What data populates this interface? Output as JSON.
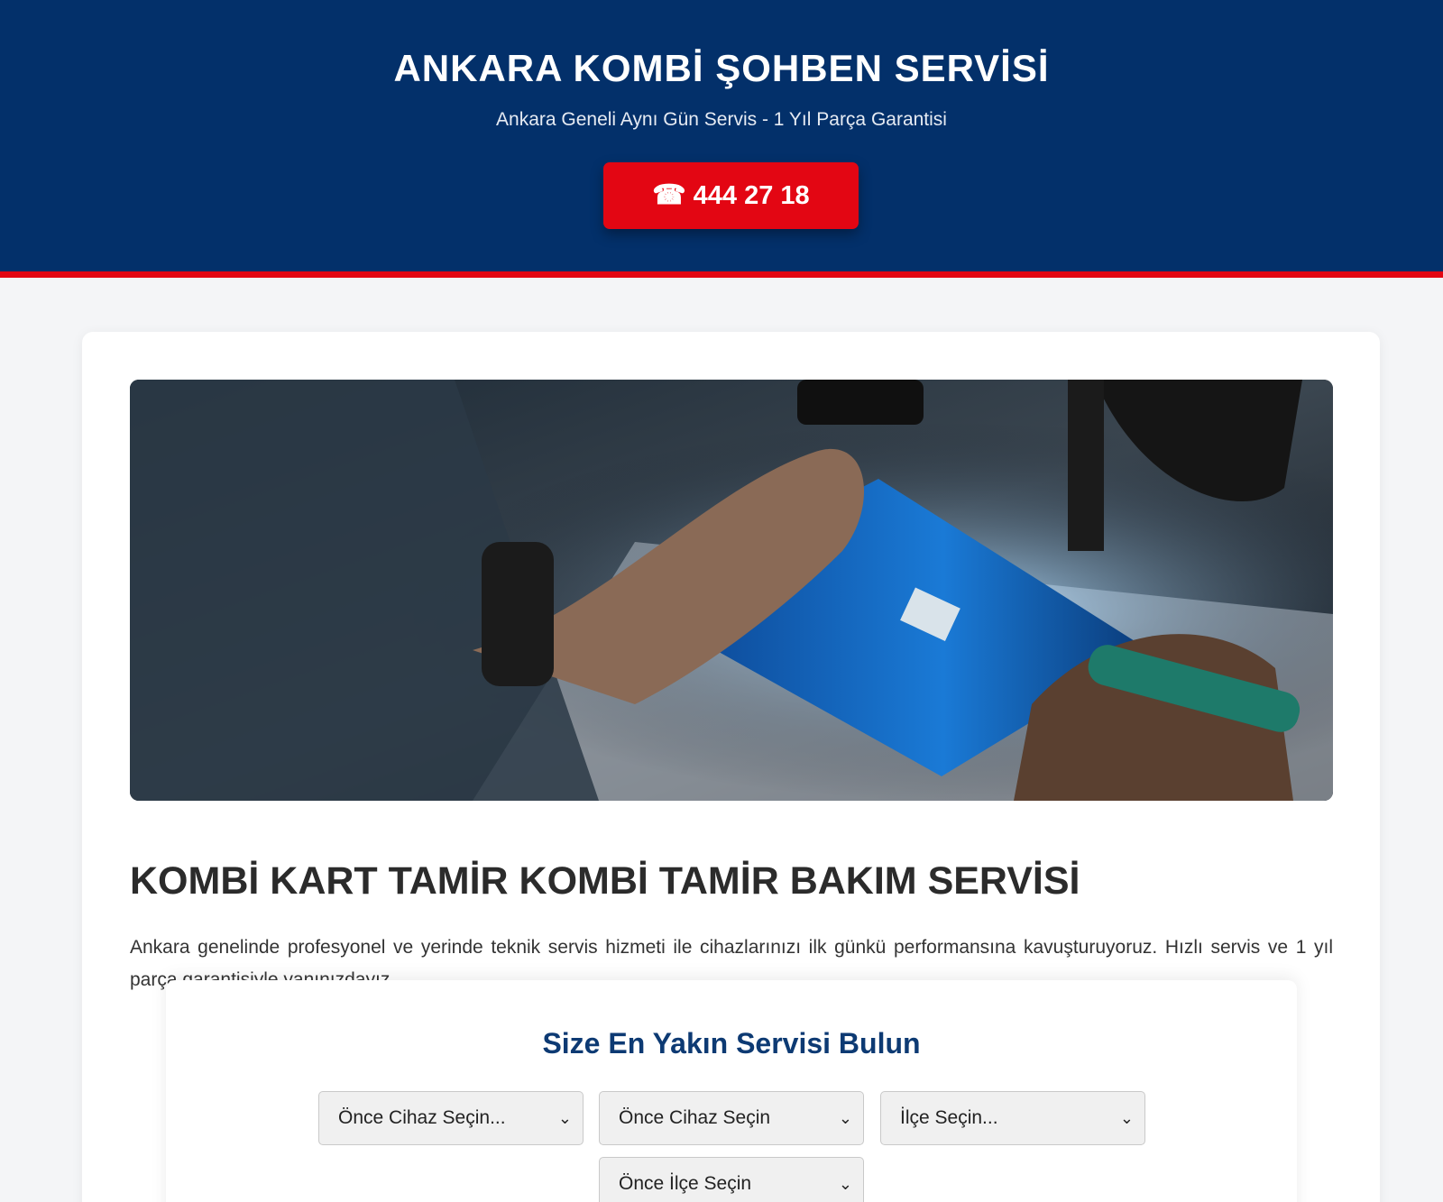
{
  "header": {
    "title": "ANKARA KOMBİ ŞOHBEN SERVİSİ",
    "subtitle": "Ankara Geneli Aynı Gün Servis - 1 Yıl Parça Garantisi",
    "call_button": {
      "icon": "phone-icon",
      "glyph": "☎",
      "label": "444 27 18"
    },
    "colors": {
      "background": "#03306a",
      "accent": "#e30613"
    }
  },
  "hero": {
    "image": "photo of a technician soldering a blue circuit board",
    "icon": "circuit-board-photo"
  },
  "main": {
    "heading": "KOMBİ KART TAMİR KOMBİ TAMİR BAKIM SERVİSİ",
    "intro": "Ankara genelinde profesyonel ve yerinde teknik servis hizmeti ile cihazlarınızı ilk günkü performansına kavuşturuyoruz. Hızlı servis ve 1 yıl parça garantisiyle yanınızdayız."
  },
  "finder": {
    "title": "Size En Yakın Servisi Bulun",
    "selects": [
      {
        "value": "Önce Cihaz Seçin..."
      },
      {
        "value": "Önce Cihaz Seçin"
      },
      {
        "value": "İlçe Seçin..."
      },
      {
        "value": "Önce İlçe Seçin"
      }
    ],
    "chevron_icon": "chevron-down-icon"
  }
}
